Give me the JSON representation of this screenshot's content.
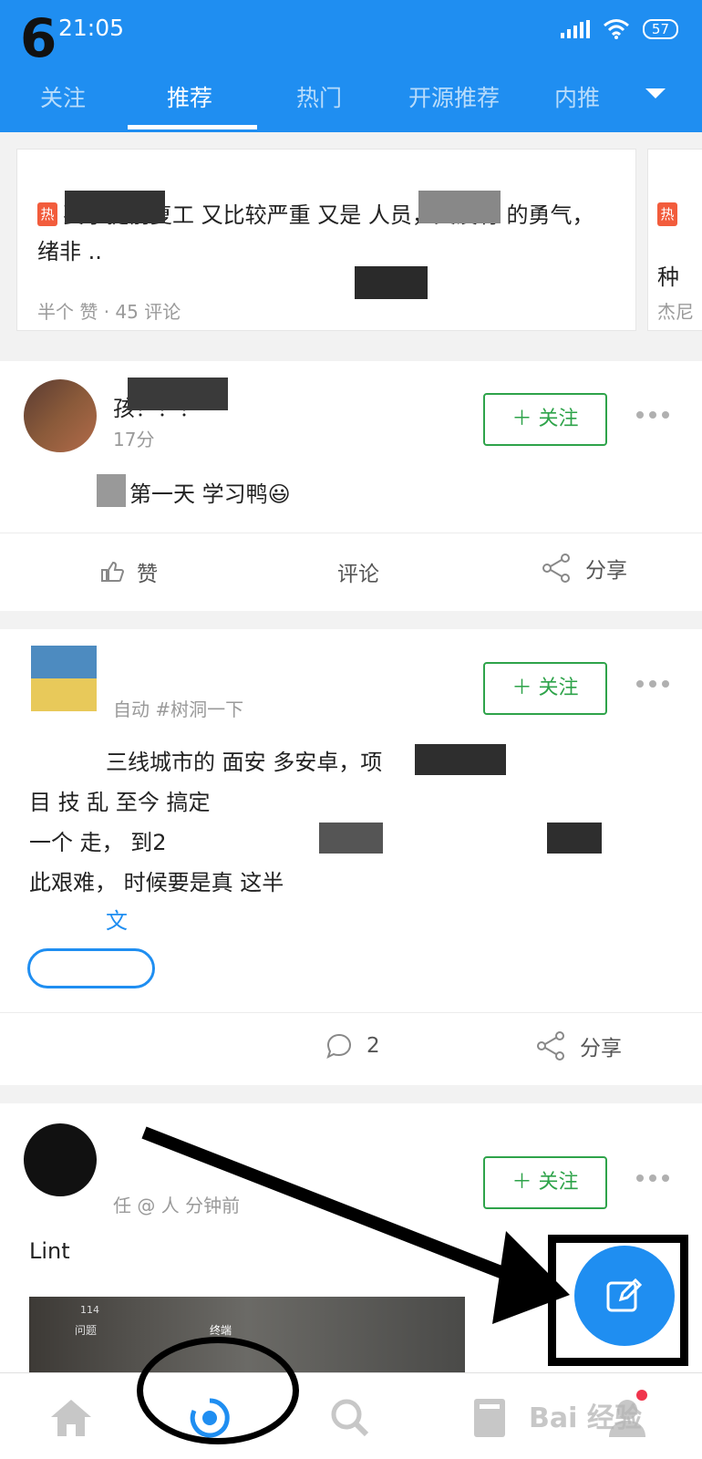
{
  "status_bar": {
    "time": "21:05",
    "battery": "57"
  },
  "step_number": "6",
  "tabs": [
    {
      "label": "关注",
      "active": false
    },
    {
      "label": "推荐",
      "active": true
    },
    {
      "label": "热门",
      "active": false
    },
    {
      "label": "开源推荐",
      "active": false
    },
    {
      "label": "内推",
      "active": false
    }
  ],
  "hot_card": {
    "badge": "热",
    "text": "要求提前复工 又比较严重 又是 人员，又没有 的勇气， 绪非 ..",
    "meta": "半个 赞 · 45 评论",
    "next_card_badge": "热",
    "next_card_text": "种",
    "next_card_meta": "杰尼"
  },
  "post1": {
    "author": "孩！！！",
    "time": "17分",
    "follow_label": "＋ 关注",
    "body": "第一天 学习鸭😃",
    "like_label": "赞",
    "comment_label": "评论",
    "share_label": "分享"
  },
  "post2": {
    "sub": "自动 #树洞一下",
    "follow_label": "＋ 关注",
    "body_lines": [
      "三线城市的 面安 多安卓，项",
      "目 技 乱 至今 搞定",
      "一个 走， 到2",
      "此艰难， 时候要是真 这半"
    ],
    "link": "文",
    "comment_count": "2",
    "share_label": "分享"
  },
  "post3": {
    "sub": "任 @ 人 分钟前",
    "follow_label": "＋ 关注",
    "body": "Lint",
    "thumb_labels": [
      "114",
      "问题",
      "终端"
    ]
  },
  "watermark": "Bai 经验",
  "colors": {
    "primary": "#1f8ef1",
    "follow": "#2ea34a",
    "hot": "#f25c3c"
  }
}
